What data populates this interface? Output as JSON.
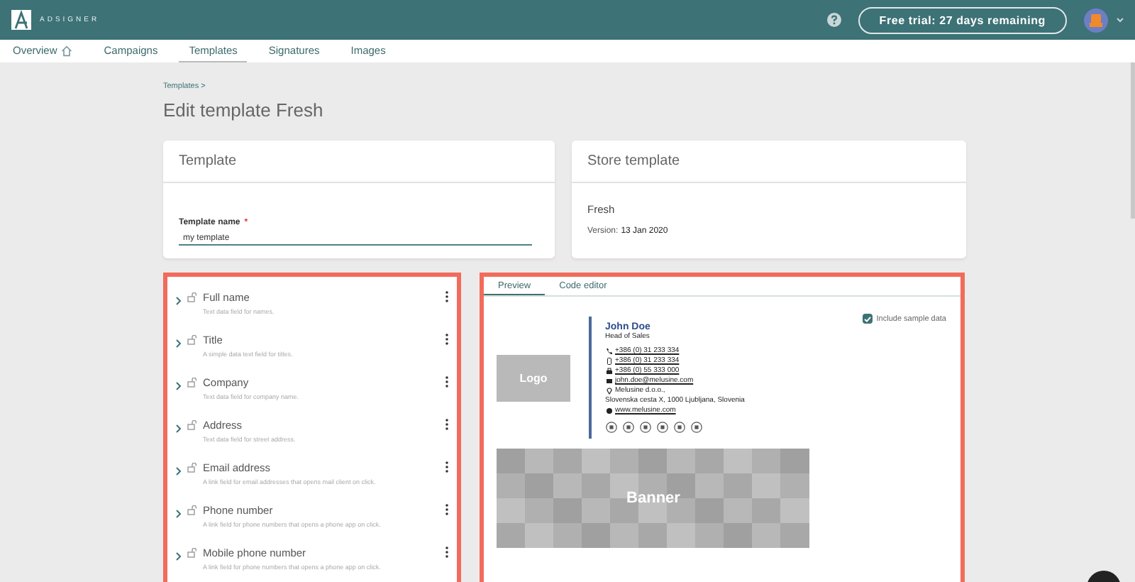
{
  "header": {
    "logo_text": "ADSIGNER",
    "trial_button": "Free trial: 27 days remaining"
  },
  "nav": [
    {
      "label": "Overview",
      "selected": false
    },
    {
      "label": "Campaigns",
      "selected": false
    },
    {
      "label": "Templates",
      "selected": true
    },
    {
      "label": "Signatures",
      "selected": false
    },
    {
      "label": "Images",
      "selected": false
    }
  ],
  "breadcrumb": "Templates >",
  "page_title": "Edit template Fresh",
  "template_card": {
    "title": "Template",
    "field_label": "Template name",
    "required_mark": "*",
    "field_value": "my template"
  },
  "store_card": {
    "title": "Store template",
    "name": "Fresh",
    "version_label": "Version:",
    "version": "13 Jan 2020"
  },
  "fields": [
    {
      "name": "Full name",
      "description": "Text data field for names."
    },
    {
      "name": "Title",
      "description": "A simple data text field for titles."
    },
    {
      "name": "Company",
      "description": "Text data field for company name."
    },
    {
      "name": "Address",
      "description": "Text data field for street address."
    },
    {
      "name": "Email address",
      "description": "A link field for email addresses that opens mail client on click."
    },
    {
      "name": "Phone number",
      "description": "A link field for phone numbers that opens a phone app on click."
    },
    {
      "name": "Mobile phone number",
      "description": "A link field for phone numbers that opens a phone app on click."
    }
  ],
  "preview_tabs": [
    {
      "label": "Preview",
      "selected": true
    },
    {
      "label": "Code editor",
      "selected": false
    }
  ],
  "include_sample": {
    "label": "Include sample data",
    "checked": true
  },
  "signature": {
    "logo": "Logo",
    "name": "John Doe",
    "job_title": "Head of Sales",
    "lines": [
      {
        "kind": "phone",
        "text": "+386 (0) 31 233 334",
        "link": true
      },
      {
        "kind": "mobile",
        "text": "+386 (0) 31 233 334",
        "link": true
      },
      {
        "kind": "fax",
        "text": "+386 (0) 55 333 000",
        "link": true
      },
      {
        "kind": "email",
        "text": "john.doe@melusine.com",
        "link": true
      },
      {
        "kind": "pin",
        "text": "Melusine d.o.o.,",
        "link": false
      },
      {
        "kind": "none",
        "text": "Slovenska cesta X, 1000 Ljubljana, Slovenia",
        "link": false
      },
      {
        "kind": "globe",
        "text": "www.melusine.com",
        "link": true
      }
    ],
    "banner": "Banner"
  }
}
